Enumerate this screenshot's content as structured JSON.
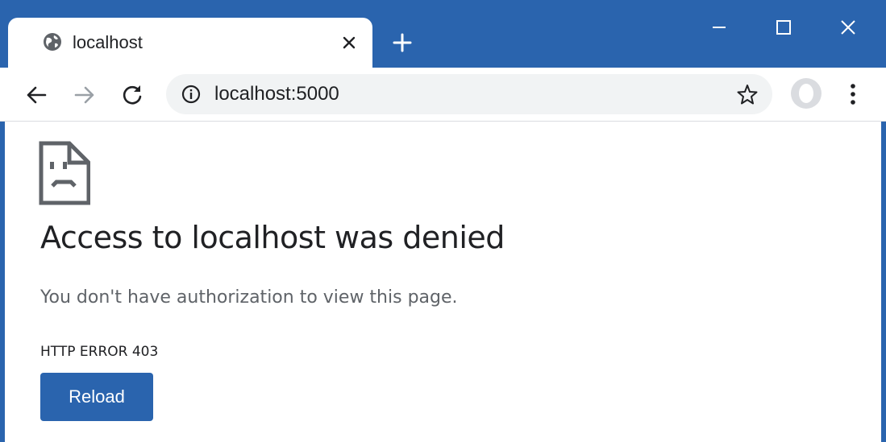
{
  "tab": {
    "title": "localhost",
    "favicon": "globe-icon",
    "close_icon": "close-icon"
  },
  "toolbar": {
    "url": "localhost:5000",
    "icons": [
      "back-arrow-icon",
      "forward-arrow-icon",
      "reload-icon",
      "info-icon",
      "star-icon",
      "avatar-icon",
      "more-vert-icon"
    ]
  },
  "window_controls": [
    "minimize-icon",
    "maximize-icon",
    "close-icon"
  ],
  "page": {
    "icon": "sad-file-icon",
    "title": "Access to localhost was denied",
    "description": "You don't have authorization to view this page.",
    "error_code": "HTTP ERROR 403",
    "reload_label": "Reload"
  },
  "colors": {
    "frame": "#2a64ae",
    "button": "#2a64ae",
    "text": "#202124",
    "secondary_text": "#5f6368"
  }
}
